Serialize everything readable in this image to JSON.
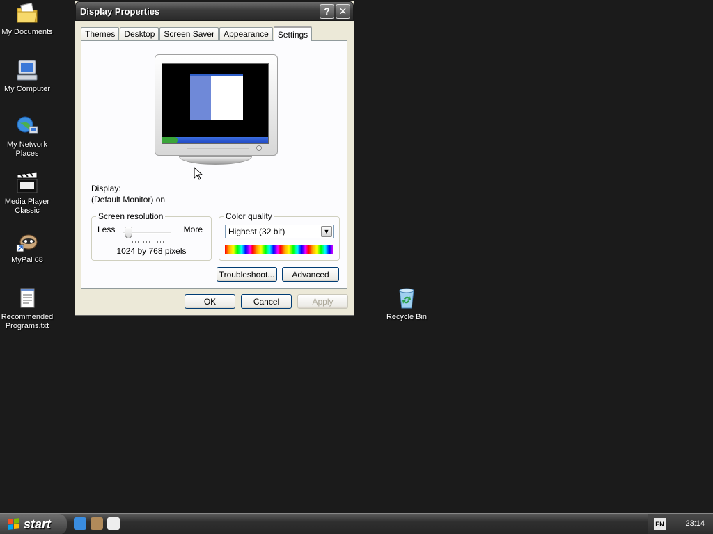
{
  "desktop": {
    "icons": [
      {
        "label": "My Documents",
        "icon": "folder-documents-icon"
      },
      {
        "label": "My Computer",
        "icon": "computer-icon"
      },
      {
        "label": "My Network\nPlaces",
        "icon": "network-places-icon"
      },
      {
        "label": "Media Player\nClassic",
        "icon": "media-player-icon"
      },
      {
        "label": "MyPal 68",
        "icon": "mypal-browser-icon"
      },
      {
        "label": "Recommended\nPrograms.txt",
        "icon": "text-file-icon"
      },
      {
        "label": "Recycle Bin",
        "icon": "recycle-bin-icon"
      }
    ]
  },
  "window": {
    "title": "Display Properties",
    "help_glyph": "?",
    "close_glyph": "✕",
    "tabs": [
      {
        "label": "Themes"
      },
      {
        "label": "Desktop"
      },
      {
        "label": "Screen Saver"
      },
      {
        "label": "Appearance"
      },
      {
        "label": "Settings"
      }
    ],
    "active_tab": "Settings",
    "display_label": "Display:",
    "display_value": "(Default Monitor) on",
    "resolution": {
      "legend": "Screen resolution",
      "less": "Less",
      "more": "More",
      "value": "1024 by 768 pixels"
    },
    "color_quality": {
      "legend": "Color quality",
      "selected": "Highest (32 bit)"
    },
    "buttons": {
      "troubleshoot": "Troubleshoot...",
      "advanced": "Advanced",
      "ok": "OK",
      "cancel": "Cancel",
      "apply": "Apply"
    },
    "preview": {
      "mini_start": "start"
    }
  },
  "taskbar": {
    "start_label": "start",
    "language": "EN",
    "clock": "23:14"
  },
  "colors": {
    "desktop": "#1b1b1b",
    "window_face": "#ece9d8",
    "button_border": "#003c74"
  }
}
